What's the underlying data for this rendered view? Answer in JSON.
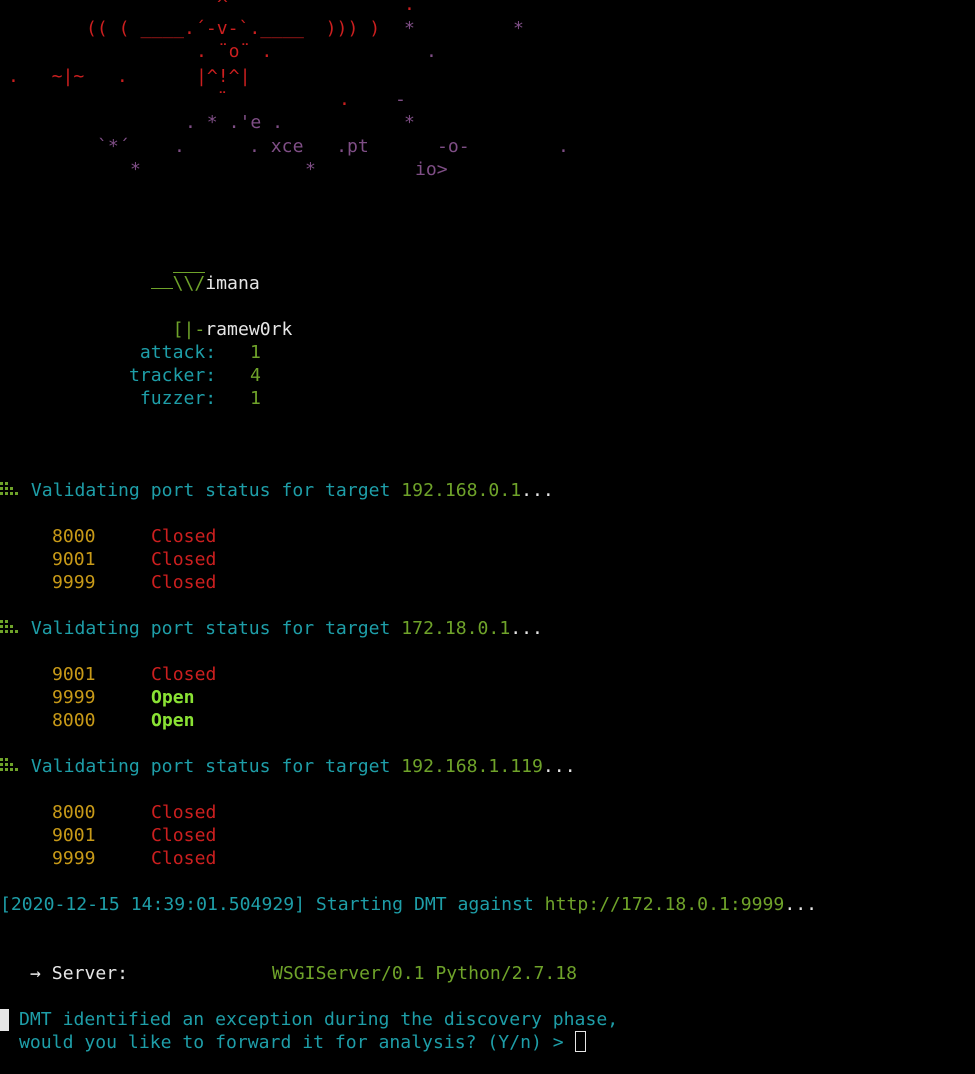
{
  "banner": {
    "lines": [
      {
        "row": 0,
        "parts": [
          {
            "col": 217,
            "text": "^",
            "cls": "c-red"
          },
          {
            "col": 404,
            "text": ".",
            "cls": "c-red"
          }
        ]
      },
      {
        "row": 1,
        "parts": [
          {
            "col": 86,
            "text": "(( ( ____.´-v-`.____  ))) )",
            "cls": "c-red"
          },
          {
            "col": 404,
            "text": "*",
            "cls": "c-purple"
          },
          {
            "col": 513,
            "text": "*",
            "cls": "c-purple"
          }
        ]
      },
      {
        "row": 2,
        "parts": [
          {
            "col": 196,
            "text": ". ¨o¨ .",
            "cls": "c-red"
          },
          {
            "col": 426,
            "text": ".",
            "cls": "c-purple"
          }
        ]
      },
      {
        "row": 3,
        "parts": [
          {
            "col": 8,
            "text": ".   ~|~   .",
            "cls": "c-red"
          },
          {
            "col": 196,
            "text": "|^!^|",
            "cls": "c-red"
          }
        ]
      },
      {
        "row": 4,
        "parts": [
          {
            "col": 217,
            "text": "¨",
            "cls": "c-red"
          },
          {
            "col": 339,
            "text": ".",
            "cls": "c-red"
          },
          {
            "col": 395,
            "text": "-",
            "cls": "c-purple"
          }
        ]
      },
      {
        "row": 5,
        "parts": [
          {
            "col": 185,
            "text": ". * .'e .",
            "cls": "c-purple"
          },
          {
            "col": 404,
            "text": "*",
            "cls": "c-purple"
          }
        ]
      },
      {
        "row": 6,
        "parts": [
          {
            "col": 97,
            "text": "`*´",
            "cls": "c-purple"
          },
          {
            "col": 174,
            "text": ".",
            "cls": "c-purple"
          },
          {
            "col": 249,
            "text": ". xce   .pt",
            "cls": "c-purple"
          },
          {
            "col": 437,
            "text": "-o-",
            "cls": "c-purple"
          },
          {
            "col": 558,
            "text": ".",
            "cls": "c-purple"
          }
        ]
      },
      {
        "row": 7,
        "parts": [
          {
            "col": 130,
            "text": "*",
            "cls": "c-purple"
          },
          {
            "col": 305,
            "text": "*",
            "cls": "c-purple"
          },
          {
            "col": 415,
            "text": "io>",
            "cls": "c-purple"
          }
        ]
      }
    ]
  },
  "logo": {
    "line1_prefix": "\\\\/",
    "line1_rest": "imana",
    "line2_prefix": "[|-",
    "line2_rest": "ramew0rk"
  },
  "modules": [
    {
      "label": " attack:",
      "count": "1"
    },
    {
      "label": "tracker:",
      "count": "4"
    },
    {
      "label": " fuzzer:",
      "count": "1"
    }
  ],
  "scans": [
    {
      "text": " Validating port status for target ",
      "target": "192.168.0.1",
      "ellipsis": "...",
      "ports": [
        {
          "port": "8000",
          "status": "Closed",
          "open": false
        },
        {
          "port": "9001",
          "status": "Closed",
          "open": false
        },
        {
          "port": "9999",
          "status": "Closed",
          "open": false
        }
      ]
    },
    {
      "text": " Validating port status for target ",
      "target": "172.18.0.1",
      "ellipsis": "...",
      "ports": [
        {
          "port": "9001",
          "status": "Closed",
          "open": false
        },
        {
          "port": "9999",
          "status": "Open",
          "open": true
        },
        {
          "port": "8000",
          "status": "Open",
          "open": true
        }
      ]
    },
    {
      "text": " Validating port status for target ",
      "target": "192.168.1.119",
      "ellipsis": "...",
      "ports": [
        {
          "port": "8000",
          "status": "Closed",
          "open": false
        },
        {
          "port": "9001",
          "status": "Closed",
          "open": false
        },
        {
          "port": "9999",
          "status": "Closed",
          "open": false
        }
      ]
    }
  ],
  "start_line": {
    "timestamp": "[2020-12-15 14:39:01.504929]",
    "text": " Starting DMT against ",
    "url": "http://172.18.0.1:9999",
    "ellipsis": "..."
  },
  "server_line": {
    "arrow": "→",
    "label": " Server:",
    "value": "WSGIServer/0.1 Python/2.7.18"
  },
  "prompt": {
    "line1": "DMT identified an exception during the discovery phase,",
    "line2": "would you like to forward it for analysis? (Y/n) > "
  },
  "colors": {
    "background": "#000000",
    "red": "#cc1f1f",
    "purple": "#7f4e86",
    "green": "#6fa32a",
    "teal": "#1e9ea8",
    "yellow": "#c89a18",
    "open_green": "#8ae234"
  },
  "icons": {
    "scan_icon": "grid-bars-icon"
  }
}
